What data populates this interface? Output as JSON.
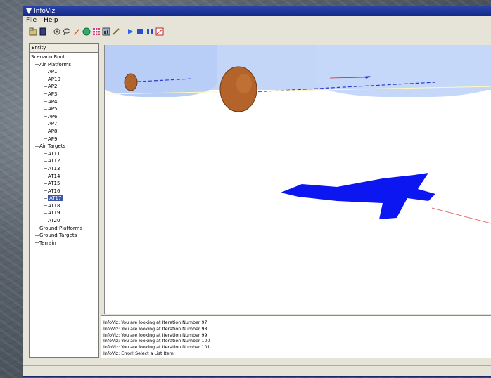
{
  "window": {
    "title": "InfoViz"
  },
  "menu": {
    "file": "File",
    "help": "Help"
  },
  "toolbar_icons": [
    "open-icon",
    "book-icon",
    "gear-icon",
    "lasso-icon",
    "rocket-icon",
    "globe-icon",
    "grid-icon",
    "chart-icon",
    "brush-icon",
    "play-icon",
    "stop-icon",
    "pause-icon",
    "graph-icon"
  ],
  "tree": {
    "column_header": "Entity",
    "rows": [
      {
        "label": "Scenario Root",
        "depth": 0
      },
      {
        "label": "Air Platforms",
        "depth": 1
      },
      {
        "label": "AP1",
        "depth": 2
      },
      {
        "label": "AP10",
        "depth": 2
      },
      {
        "label": "AP2",
        "depth": 2
      },
      {
        "label": "AP3",
        "depth": 2
      },
      {
        "label": "AP4",
        "depth": 2
      },
      {
        "label": "AP5",
        "depth": 2
      },
      {
        "label": "AP6",
        "depth": 2
      },
      {
        "label": "AP7",
        "depth": 2
      },
      {
        "label": "AP8",
        "depth": 2
      },
      {
        "label": "AP9",
        "depth": 2
      },
      {
        "label": "Air Targets",
        "depth": 1
      },
      {
        "label": "AT11",
        "depth": 2
      },
      {
        "label": "AT12",
        "depth": 2
      },
      {
        "label": "AT13",
        "depth": 2
      },
      {
        "label": "AT14",
        "depth": 2
      },
      {
        "label": "AT15",
        "depth": 2
      },
      {
        "label": "AT16",
        "depth": 2
      },
      {
        "label": "AT17",
        "depth": 2,
        "selected": true
      },
      {
        "label": "AT18",
        "depth": 2
      },
      {
        "label": "AT19",
        "depth": 2
      },
      {
        "label": "AT20",
        "depth": 2
      },
      {
        "label": "Ground Platforms",
        "depth": 1
      },
      {
        "label": "Ground Targets",
        "depth": 1
      },
      {
        "label": "Terrain",
        "depth": 1
      }
    ]
  },
  "log": [
    "InfoViz: You are looking at Iteration Number 97",
    "InfoViz: You are looking at Iteration Number 98",
    "InfoViz: You are looking at Iteration Number 99",
    "InfoViz: You are looking at Iteration Number 100",
    "InfoViz: You are looking at Iteration Number 101",
    "InfoViz: Error! Select a List Item"
  ]
}
